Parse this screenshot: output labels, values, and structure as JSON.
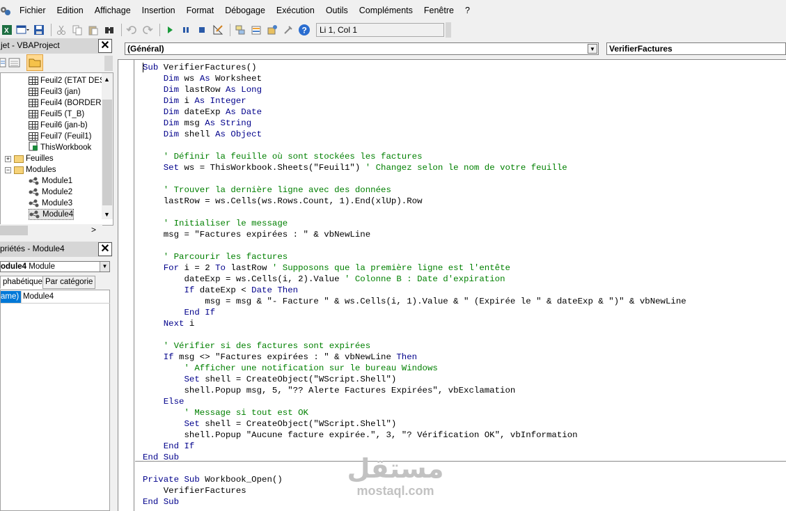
{
  "menu": [
    "Fichier",
    "Edition",
    "Affichage",
    "Insertion",
    "Format",
    "Débogage",
    "Exécution",
    "Outils",
    "Compléments",
    "Fenêtre",
    "?"
  ],
  "toolbar": {
    "position_text": "Li 1, Col 1",
    "icons": [
      "excel-icon",
      "insert-userform-icon",
      "save-icon",
      "cut-icon",
      "copy-icon",
      "paste-icon",
      "find-icon",
      "undo-icon",
      "redo-icon",
      "run-icon",
      "break-icon",
      "reset-icon",
      "design-mode-icon",
      "project-explorer-icon",
      "properties-icon",
      "object-browser-icon",
      "toolbox-icon",
      "help-icon"
    ]
  },
  "project": {
    "title": "jet - VBAProject",
    "close_label": "✕",
    "tree": [
      {
        "label": "Feuil2 (ETAT DES",
        "kind": "sheet"
      },
      {
        "label": "Feuil3 (jan)",
        "kind": "sheet"
      },
      {
        "label": "Feuil4 (BORDERE",
        "kind": "sheet"
      },
      {
        "label": "Feuil5 (T_B)",
        "kind": "sheet"
      },
      {
        "label": "Feuil6 (jan-b)",
        "kind": "sheet"
      },
      {
        "label": "Feuil7 (Feuil1)",
        "kind": "sheet"
      },
      {
        "label": "ThisWorkbook",
        "kind": "workbook"
      },
      {
        "label": "Feuilles",
        "kind": "folder",
        "expander": "+"
      },
      {
        "label": "Modules",
        "kind": "folder",
        "expander": "−"
      },
      {
        "label": "Module1",
        "kind": "module"
      },
      {
        "label": "Module2",
        "kind": "module"
      },
      {
        "label": "Module3",
        "kind": "module"
      },
      {
        "label": "Module4",
        "kind": "module",
        "selected": true
      }
    ]
  },
  "properties": {
    "title": "priétés - Module4",
    "close_label": "✕",
    "combo_name": "odule4",
    "combo_type": "Module",
    "tabs": [
      "phabétique",
      "Par catégorie"
    ],
    "rows": [
      {
        "name": "ame)",
        "value": "Module4"
      }
    ]
  },
  "code_window": {
    "object_combo": "(Général)",
    "proc_combo": "VerifierFactures",
    "lines": [
      [
        [
          "kw",
          "Sub"
        ],
        [
          "tx",
          " VerifierFactures()"
        ]
      ],
      [
        [
          "tx",
          "    "
        ],
        [
          "kw",
          "Dim"
        ],
        [
          "tx",
          " ws "
        ],
        [
          "kw",
          "As"
        ],
        [
          "tx",
          " Worksheet"
        ]
      ],
      [
        [
          "tx",
          "    "
        ],
        [
          "kw",
          "Dim"
        ],
        [
          "tx",
          " lastRow "
        ],
        [
          "kw",
          "As Long"
        ]
      ],
      [
        [
          "tx",
          "    "
        ],
        [
          "kw",
          "Dim"
        ],
        [
          "tx",
          " i "
        ],
        [
          "kw",
          "As Integer"
        ]
      ],
      [
        [
          "tx",
          "    "
        ],
        [
          "kw",
          "Dim"
        ],
        [
          "tx",
          " dateExp "
        ],
        [
          "kw",
          "As Date"
        ]
      ],
      [
        [
          "tx",
          "    "
        ],
        [
          "kw",
          "Dim"
        ],
        [
          "tx",
          " msg "
        ],
        [
          "kw",
          "As String"
        ]
      ],
      [
        [
          "tx",
          "    "
        ],
        [
          "kw",
          "Dim"
        ],
        [
          "tx",
          " shell "
        ],
        [
          "kw",
          "As Object"
        ]
      ],
      [
        [
          "tx",
          ""
        ]
      ],
      [
        [
          "tx",
          "    "
        ],
        [
          "cm",
          "' Définir la feuille où sont stockées les factures"
        ]
      ],
      [
        [
          "tx",
          "    "
        ],
        [
          "kw",
          "Set"
        ],
        [
          "tx",
          " ws = ThisWorkbook.Sheets(\"Feuil1\") "
        ],
        [
          "cm",
          "' Changez selon le nom de votre feuille"
        ]
      ],
      [
        [
          "tx",
          ""
        ]
      ],
      [
        [
          "tx",
          "    "
        ],
        [
          "cm",
          "' Trouver la dernière ligne avec des données"
        ]
      ],
      [
        [
          "tx",
          "    lastRow = ws.Cells(ws.Rows.Count, 1).End(xlUp).Row"
        ]
      ],
      [
        [
          "tx",
          ""
        ]
      ],
      [
        [
          "tx",
          "    "
        ],
        [
          "cm",
          "' Initialiser le message"
        ]
      ],
      [
        [
          "tx",
          "    msg = \"Factures expirées : \" & vbNewLine"
        ]
      ],
      [
        [
          "tx",
          ""
        ]
      ],
      [
        [
          "tx",
          "    "
        ],
        [
          "cm",
          "' Parcourir les factures"
        ]
      ],
      [
        [
          "tx",
          "    "
        ],
        [
          "kw",
          "For"
        ],
        [
          "tx",
          " i = 2 "
        ],
        [
          "kw",
          "To"
        ],
        [
          "tx",
          " lastRow "
        ],
        [
          "cm",
          "' Supposons que la première ligne est l'entête"
        ]
      ],
      [
        [
          "tx",
          "        dateExp = ws.Cells(i, 2).Value "
        ],
        [
          "cm",
          "' Colonne B : Date d'expiration"
        ]
      ],
      [
        [
          "tx",
          "        "
        ],
        [
          "kw",
          "If"
        ],
        [
          "tx",
          " dateExp < "
        ],
        [
          "kw",
          "Date Then"
        ]
      ],
      [
        [
          "tx",
          "            msg = msg & \"- Facture \" & ws.Cells(i, 1).Value & \" (Expirée le \" & dateExp & \")\" & vbNewLine"
        ]
      ],
      [
        [
          "tx",
          "        "
        ],
        [
          "kw",
          "End If"
        ]
      ],
      [
        [
          "tx",
          "    "
        ],
        [
          "kw",
          "Next"
        ],
        [
          "tx",
          " i"
        ]
      ],
      [
        [
          "tx",
          ""
        ]
      ],
      [
        [
          "tx",
          "    "
        ],
        [
          "cm",
          "' Vérifier si des factures sont expirées"
        ]
      ],
      [
        [
          "tx",
          "    "
        ],
        [
          "kw",
          "If"
        ],
        [
          "tx",
          " msg <> \"Factures expirées : \" & vbNewLine "
        ],
        [
          "kw",
          "Then"
        ]
      ],
      [
        [
          "tx",
          "        "
        ],
        [
          "cm",
          "' Afficher une notification sur le bureau Windows"
        ]
      ],
      [
        [
          "tx",
          "        "
        ],
        [
          "kw",
          "Set"
        ],
        [
          "tx",
          " shell = CreateObject(\"WScript.Shell\")"
        ]
      ],
      [
        [
          "tx",
          "        shell.Popup msg, 5, \"?? Alerte Factures Expirées\", vbExclamation"
        ]
      ],
      [
        [
          "tx",
          "    "
        ],
        [
          "kw",
          "Else"
        ]
      ],
      [
        [
          "tx",
          "        "
        ],
        [
          "cm",
          "' Message si tout est OK"
        ]
      ],
      [
        [
          "tx",
          "        "
        ],
        [
          "kw",
          "Set"
        ],
        [
          "tx",
          " shell = CreateObject(\"WScript.Shell\")"
        ]
      ],
      [
        [
          "tx",
          "        shell.Popup \"Aucune facture expirée.\", 3, \"? Vérification OK\", vbInformation"
        ]
      ],
      [
        [
          "tx",
          "    "
        ],
        [
          "kw",
          "End If"
        ]
      ],
      [
        [
          "kw",
          "End Sub"
        ]
      ],
      [
        [
          "tx",
          ""
        ]
      ],
      [
        [
          "kw",
          "Private Sub"
        ],
        [
          "tx",
          " Workbook_Open()"
        ]
      ],
      [
        [
          "tx",
          "    VerifierFactures"
        ]
      ],
      [
        [
          "kw",
          "End Sub"
        ]
      ]
    ]
  },
  "watermark": {
    "arabic": "مستقل",
    "latin": "mostaql.com"
  },
  "colors": {
    "keyword": "#00008b",
    "comment": "#008000",
    "selection": "#0078d7"
  }
}
